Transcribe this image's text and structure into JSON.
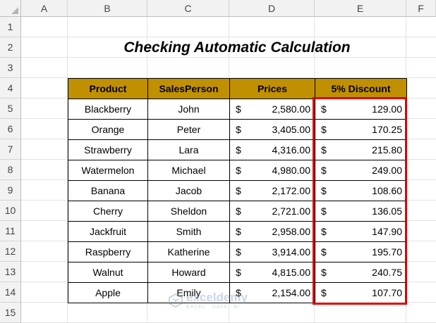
{
  "columns": [
    "A",
    "B",
    "C",
    "D",
    "E",
    "F"
  ],
  "rows": [
    "1",
    "2",
    "3",
    "4",
    "5",
    "6",
    "7",
    "8",
    "9",
    "10",
    "11",
    "12",
    "13",
    "14",
    "15"
  ],
  "title": "Checking Automatic Calculation",
  "headers": [
    "Product",
    "SalesPerson",
    "Prices",
    "5% Discount"
  ],
  "currency_symbol": "$",
  "table": [
    {
      "product": "Blackberry",
      "salesperson": "John",
      "price": "2,580.00",
      "discount": "129.00"
    },
    {
      "product": "Orange",
      "salesperson": "Peter",
      "price": "3,405.00",
      "discount": "170.25"
    },
    {
      "product": "Strawberry",
      "salesperson": "Lara",
      "price": "4,316.00",
      "discount": "215.80"
    },
    {
      "product": "Watermelon",
      "salesperson": "Michael",
      "price": "4,980.00",
      "discount": "249.00"
    },
    {
      "product": "Banana",
      "salesperson": "Jacob",
      "price": "2,172.00",
      "discount": "108.60"
    },
    {
      "product": "Cherry",
      "salesperson": "Sheldon",
      "price": "2,721.00",
      "discount": "136.05"
    },
    {
      "product": "Jackfruit",
      "salesperson": "Smith",
      "price": "2,958.00",
      "discount": "147.90"
    },
    {
      "product": "Raspberry",
      "salesperson": "Katherine",
      "price": "3,914.00",
      "discount": "195.70"
    },
    {
      "product": "Walnut",
      "salesperson": "Howard",
      "price": "4,815.00",
      "discount": "240.75"
    },
    {
      "product": "Apple",
      "salesperson": "Emily",
      "price": "2,154.00",
      "discount": "107.70"
    }
  ],
  "watermark": {
    "name": "exceldemy",
    "tagline": "EXCEL · DATA · BI"
  },
  "colors": {
    "header_fill": "#c09000",
    "highlight": "#e00000"
  }
}
